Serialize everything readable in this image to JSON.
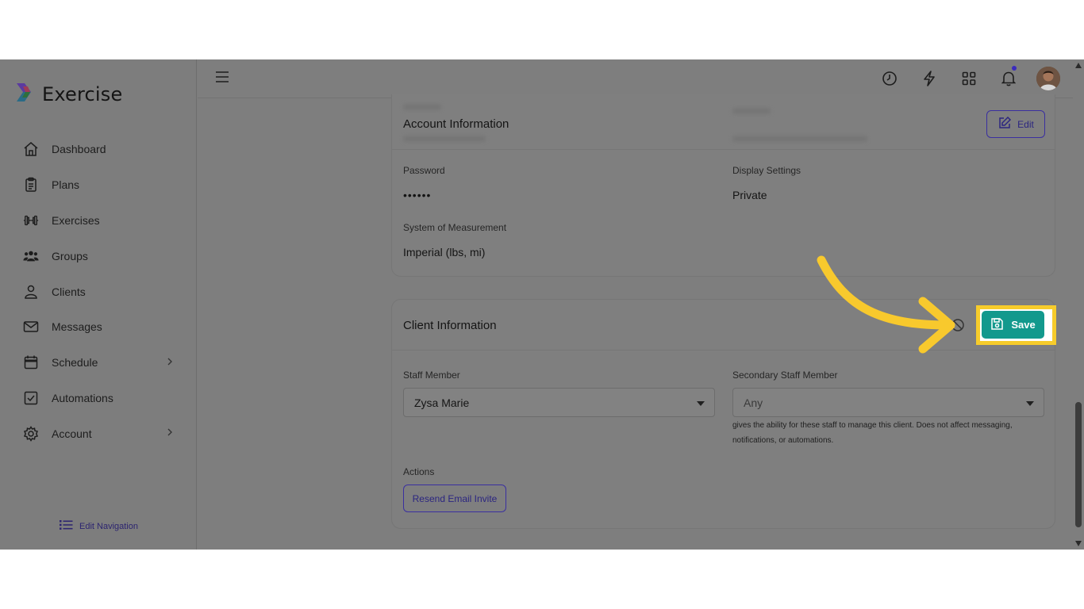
{
  "app": {
    "name": "Exercise"
  },
  "sidebar": {
    "items": [
      {
        "label": "Dashboard",
        "icon": "home-icon"
      },
      {
        "label": "Plans",
        "icon": "clipboard-icon"
      },
      {
        "label": "Exercises",
        "icon": "dumbbell-icon"
      },
      {
        "label": "Groups",
        "icon": "users-icon"
      },
      {
        "label": "Clients",
        "icon": "user-icon"
      },
      {
        "label": "Messages",
        "icon": "envelope-icon"
      },
      {
        "label": "Schedule",
        "icon": "calendar-icon",
        "expandable": true
      },
      {
        "label": "Automations",
        "icon": "checkbox-icon"
      },
      {
        "label": "Account",
        "icon": "gear-icon",
        "expandable": true
      }
    ],
    "edit_navigation": "Edit Navigation"
  },
  "topbar": {
    "icons": [
      "clock-icon",
      "lightning-icon",
      "grid-icon",
      "bell-icon"
    ],
    "has_notification": true
  },
  "account_info": {
    "title": "Account Information",
    "edit_label": "Edit",
    "password_label": "Password",
    "password_value": "••••••",
    "display_label": "Display Settings",
    "display_value": "Private",
    "measurement_label": "System of Measurement",
    "measurement_value": "Imperial (lbs, mi)"
  },
  "client_info": {
    "title": "Client Information",
    "save_label": "Save",
    "staff_label": "Staff Member",
    "staff_value": "Zysa Marie",
    "secondary_label": "Secondary Staff Member",
    "secondary_value": "Any",
    "secondary_help": "gives the ability for these staff to manage this client. Does not affect messaging, notifications, or automations.",
    "actions_label": "Actions",
    "resend_label": "Resend Email Invite"
  },
  "colors": {
    "accent": "#3a2fa0",
    "save": "#12998d",
    "highlight": "#f7cc2b",
    "overlay": "#7e7e7e"
  }
}
